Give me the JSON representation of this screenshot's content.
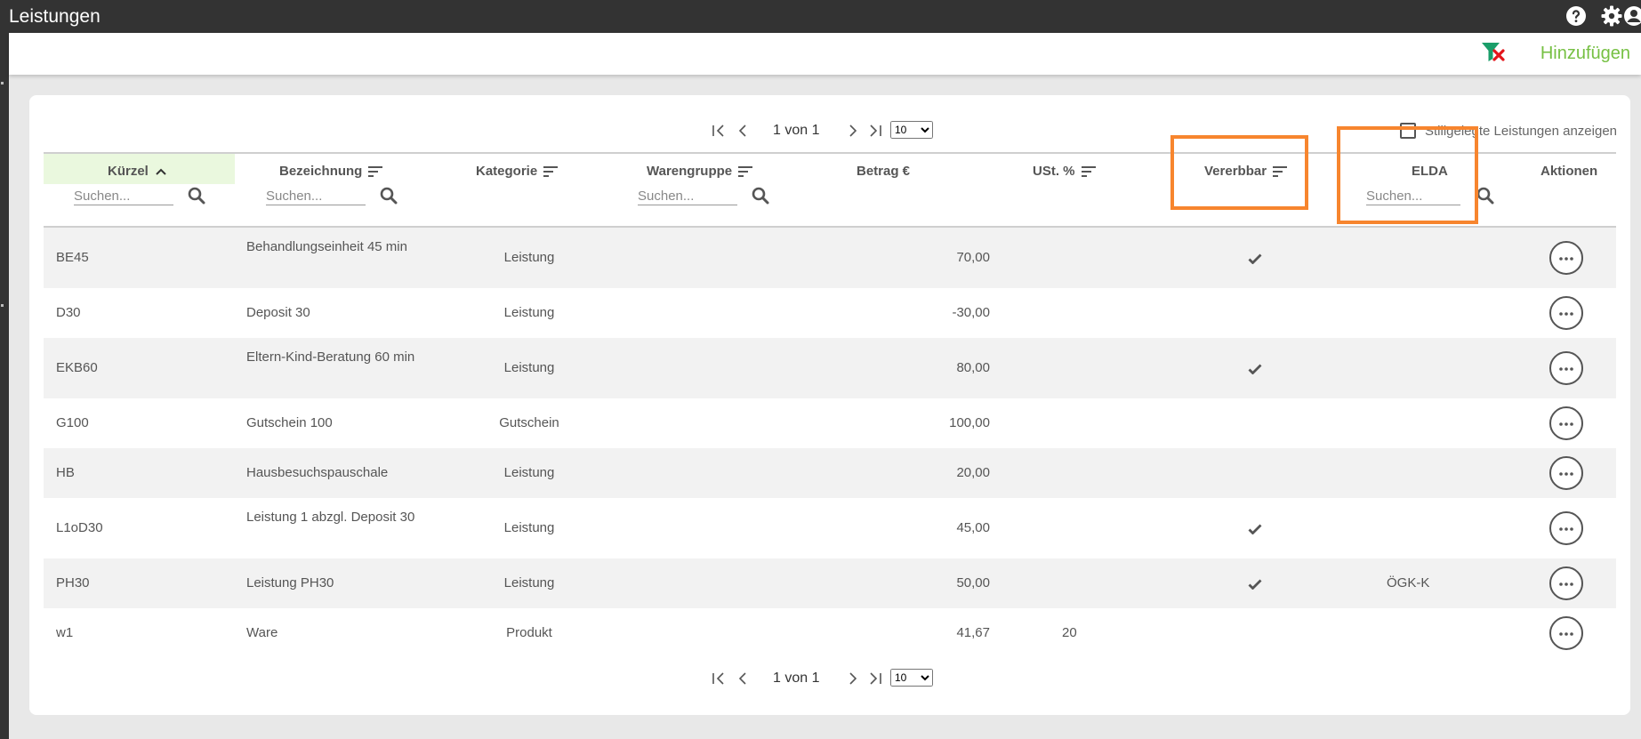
{
  "app": {
    "title": "Leistungen"
  },
  "topbar": {
    "icons": [
      "help-icon",
      "gear-icon",
      "user-icon"
    ]
  },
  "toolbar": {
    "clear_filter_icon": "filter-clear-icon",
    "add_label": "Hinzufügen",
    "accent": "#76c043"
  },
  "pager": {
    "text": "1 von 1",
    "page_size": "10",
    "page_size_options": [
      "10"
    ]
  },
  "options": {
    "show_inactive_label": "Stillgelegte Leistungen anzeigen"
  },
  "table": {
    "columns": [
      {
        "key": "code",
        "label": "Kürzel"
      },
      {
        "key": "name",
        "label": "Bezeichnung"
      },
      {
        "key": "category",
        "label": "Kategorie"
      },
      {
        "key": "group",
        "label": "Warengruppe"
      },
      {
        "key": "amount",
        "label": "Betrag €"
      },
      {
        "key": "vat",
        "label": "USt. %"
      },
      {
        "key": "sellable",
        "label": "Vererbbar"
      },
      {
        "key": "elda",
        "label": "ELDA"
      },
      {
        "key": "actions",
        "label": "Aktionen"
      }
    ],
    "search_placeholder": "Suchen...",
    "sorted_column": "code",
    "rows": [
      {
        "code": "BE45",
        "name": "Behandlungseinheit 45 min",
        "category": "Leistung",
        "group": "",
        "amount": "70,00",
        "vat": "",
        "sellable": true,
        "elda": ""
      },
      {
        "code": "D30",
        "name": "Deposit 30",
        "category": "Leistung",
        "group": "",
        "amount": "-30,00",
        "vat": "",
        "sellable": false,
        "elda": ""
      },
      {
        "code": "EKB60",
        "name": "Eltern-Kind-Beratung 60 min",
        "category": "Leistung",
        "group": "",
        "amount": "80,00",
        "vat": "",
        "sellable": true,
        "elda": ""
      },
      {
        "code": "G100",
        "name": "Gutschein 100",
        "category": "Gutschein",
        "group": "",
        "amount": "100,00",
        "vat": "",
        "sellable": false,
        "elda": ""
      },
      {
        "code": "HB",
        "name": "Hausbesuchspauschale",
        "category": "Leistung",
        "group": "",
        "amount": "20,00",
        "vat": "",
        "sellable": false,
        "elda": ""
      },
      {
        "code": "L1oD30",
        "name": "Leistung 1 abzgl. Deposit 30",
        "category": "Leistung",
        "group": "",
        "amount": "45,00",
        "vat": "",
        "sellable": true,
        "elda": ""
      },
      {
        "code": "PH30",
        "name": "Leistung PH30",
        "category": "Leistung",
        "group": "",
        "amount": "50,00",
        "vat": "",
        "sellable": true,
        "elda": "ÖGK-K"
      },
      {
        "code": "w1",
        "name": "Ware",
        "category": "Produkt",
        "group": "",
        "amount": "41,67",
        "vat": "20",
        "sellable": false,
        "elda": ""
      }
    ]
  },
  "annotations": {
    "highlight_color": "#f7852e",
    "highlighted_columns": [
      "sellable",
      "elda"
    ]
  }
}
